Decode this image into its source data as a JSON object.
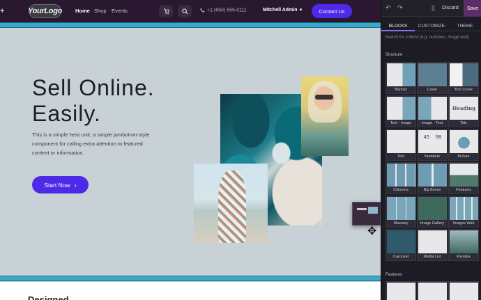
{
  "site": {
    "logo": "YourLogo",
    "nav": {
      "home": "Home",
      "shop": "Shop",
      "events": "Events",
      "plus": "+"
    },
    "phone": "+1 (650) 555-0111",
    "admin": "Mitchell Admin",
    "contact": "Contact Us"
  },
  "hero": {
    "title_line1": "Sell Online.",
    "title_line2": "Easily.",
    "text": "This is a simple hero unit, a simple jumbotron-style component for calling extra attention to featured content or information.",
    "cta": "Start Now",
    "cta_icon": "chevron-right-icon"
  },
  "below": {
    "title": "Designed",
    "text": "... ...... ......... ... ..... ..."
  },
  "editor": {
    "discard": "Discard",
    "save": "Save",
    "tabs": [
      "BLOCKS",
      "CUSTOMIZE",
      "THEME"
    ],
    "search_placeholder": "Search for a block (e.g. numbers, image wall)",
    "section_structure": "Structure",
    "section_features": "Features",
    "blocks": [
      {
        "label": "Banner",
        "thumb": "banner"
      },
      {
        "label": "Cover",
        "thumb": "cover"
      },
      {
        "label": "Text Cover",
        "thumb": "text-cover"
      },
      {
        "label": "Text - Image",
        "thumb": "text-image"
      },
      {
        "label": "Image - Text",
        "thumb": "image-text"
      },
      {
        "label": "Title",
        "thumb": "title"
      },
      {
        "label": "Text",
        "thumb": "text"
      },
      {
        "label": "Numbers",
        "thumb": "numbers"
      },
      {
        "label": "Picture",
        "thumb": "picture"
      },
      {
        "label": "Columns",
        "thumb": "columns"
      },
      {
        "label": "Big Boxes",
        "thumb": "big-boxes"
      },
      {
        "label": "Features",
        "thumb": "features"
      },
      {
        "label": "Masonry",
        "thumb": "masonry"
      },
      {
        "label": "Image Gallery",
        "thumb": "image-gallery"
      },
      {
        "label": "Images Wall",
        "thumb": "images-wall"
      },
      {
        "label": "Carousel",
        "thumb": "carousel"
      },
      {
        "label": "Media List",
        "thumb": "media-list"
      },
      {
        "label": "Parallax",
        "thumb": "parallax"
      }
    ],
    "title_thumb_text": "Heading",
    "numbers_thumb_text": "45 98",
    "colors": {
      "accent": "#4c2ae8",
      "save": "#5b2e6a",
      "drop_zone": "#3ea7c6"
    }
  }
}
